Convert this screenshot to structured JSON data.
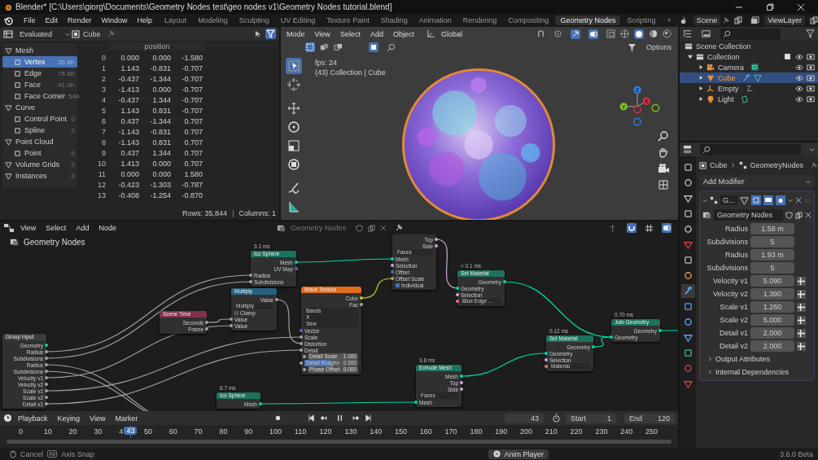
{
  "window": {
    "title": "Blender* [C:\\Users\\giorg\\Documents\\Geometry Nodes test\\geo nodes v1\\Geometry Nodes tutorial.blend]"
  },
  "menu": [
    "File",
    "Edit",
    "Render",
    "Window",
    "Help"
  ],
  "workspaces": [
    {
      "label": "Layout",
      "selected": false
    },
    {
      "label": "Modeling",
      "selected": false
    },
    {
      "label": "Sculpting",
      "selected": false
    },
    {
      "label": "UV Editing",
      "selected": false
    },
    {
      "label": "Texture Paint",
      "selected": false
    },
    {
      "label": "Shading",
      "selected": false
    },
    {
      "label": "Animation",
      "selected": false
    },
    {
      "label": "Rendering",
      "selected": false
    },
    {
      "label": "Compositing",
      "selected": false
    },
    {
      "label": "Geometry Nodes",
      "selected": true
    },
    {
      "label": "Scripting",
      "selected": false
    }
  ],
  "add_workspace": "+",
  "scene": "Scene",
  "view_layer": "ViewLayer",
  "spreadsheet": {
    "mode": "Evaluated",
    "object": "Cube",
    "domains": [
      {
        "label": "Mesh",
        "children": [
          {
            "label": "Vertex",
            "count": "35.8K",
            "selected": true
          },
          {
            "label": "Edge",
            "count": "76.8K",
            "selected": false
          },
          {
            "label": "Face",
            "count": "41.0K",
            "selected": false
          },
          {
            "label": "Face Corner",
            "count": "54K",
            "selected": false
          }
        ]
      },
      {
        "label": "Curve",
        "children": [
          {
            "label": "Control Point",
            "count": "0",
            "selected": false
          },
          {
            "label": "Spline",
            "count": "0",
            "selected": false
          }
        ]
      },
      {
        "label": "Point Cloud",
        "children": [
          {
            "label": "Point",
            "count": "0",
            "selected": false
          }
        ]
      },
      {
        "label": "Volume Grids",
        "count": "0",
        "selected": false
      },
      {
        "label": "Instances",
        "count": "0",
        "selected": false
      }
    ],
    "column": "position",
    "rows": [
      [
        "0",
        "0.000",
        "0.000",
        "-1.580"
      ],
      [
        "1",
        "1.143",
        "-0.831",
        "-0.707"
      ],
      [
        "2",
        "-0.437",
        "-1.344",
        "-0.707"
      ],
      [
        "3",
        "-1.413",
        "0.000",
        "-0.707"
      ],
      [
        "4",
        "-0.437",
        "1.344",
        "-0.707"
      ],
      [
        "5",
        "1.143",
        "0.831",
        "-0.707"
      ],
      [
        "6",
        "0.437",
        "-1.344",
        "0.707"
      ],
      [
        "7",
        "-1.143",
        "-0.831",
        "0.707"
      ],
      [
        "8",
        "-1.143",
        "0.831",
        "0.707"
      ],
      [
        "9",
        "0.437",
        "1.344",
        "0.707"
      ],
      [
        "10",
        "1.413",
        "0.000",
        "0.707"
      ],
      [
        "11",
        "0.000",
        "0.000",
        "1.580"
      ],
      [
        "12",
        "-0.423",
        "-1.303",
        "-0.787"
      ],
      [
        "13",
        "-0.408",
        "-1.254",
        "-0.870"
      ]
    ],
    "rows_count": "Rows: 35,844",
    "separator": "|",
    "columns_count": "Columns: 1"
  },
  "viewport": {
    "menu": [
      "Mode",
      "View",
      "Select",
      "Add",
      "Object"
    ],
    "orientation": "Global",
    "options": "Options",
    "fps": "fps: 24",
    "info": "(43) Collection | Cube",
    "axes": [
      "Z",
      "X",
      "Y"
    ]
  },
  "outliner": {
    "root": "Scene Collection",
    "collection": {
      "label": "Collection",
      "expanded": true,
      "checked": true
    },
    "items": [
      {
        "label": "Camera",
        "kind": "camera",
        "selected": false,
        "expanded": false
      },
      {
        "label": "Cube",
        "kind": "mesh",
        "selected": true,
        "expanded": false
      },
      {
        "label": "Empty",
        "kind": "empty",
        "selected": false,
        "expanded": false
      },
      {
        "label": "Light",
        "kind": "light",
        "selected": false,
        "expanded": false
      }
    ]
  },
  "properties": {
    "object": "Cube",
    "modifier": "GeometryNodes",
    "add_modifier": "Add Modifier",
    "modifier_short": "G...",
    "node_group": "Geometry Nodes",
    "inputs": [
      {
        "label": "Radius",
        "value": "1.58 m",
        "kind": "value"
      },
      {
        "label": "Subdivisions",
        "value": "5",
        "kind": "value"
      },
      {
        "label": "Radius",
        "value": "1.93 m",
        "kind": "value"
      },
      {
        "label": "Subdivisions",
        "value": "5",
        "kind": "value"
      },
      {
        "label": "Velocity v1",
        "value": "5.090",
        "kind": "field"
      },
      {
        "label": "Velocity v2",
        "value": "1.390",
        "kind": "field"
      },
      {
        "label": "Scale v1",
        "value": "1.260",
        "kind": "field"
      },
      {
        "label": "Scale v2",
        "value": "5.000",
        "kind": "field"
      },
      {
        "label": "Detail v1",
        "value": "2.000",
        "kind": "field"
      },
      {
        "label": "Detail v2",
        "value": "2.000",
        "kind": "field"
      }
    ],
    "sections": [
      {
        "label": "Output Attributes",
        "expanded": false
      },
      {
        "label": "Internal Dependencies",
        "expanded": false
      }
    ]
  },
  "node_editor": {
    "menu": [
      "View",
      "Select",
      "Add",
      "Node"
    ],
    "node_group": "Geometry Nodes",
    "breadcrumb": "Geometry Nodes",
    "nodes": [
      {
        "title": "Group Input",
        "color": "#3c3c3c",
        "rows": [
          {
            "kind": "out",
            "label": "Geometry",
            "color": "#00d6a3"
          },
          {
            "kind": "out",
            "label": "Radius",
            "color": "#a1a1a1"
          },
          {
            "kind": "out",
            "label": "Subdivisions",
            "color": "#a1a1a1"
          },
          {
            "kind": "out",
            "label": "Radius",
            "color": "#a1a1a1"
          },
          {
            "kind": "out",
            "label": "Subdivisions",
            "color": "#a1a1a1"
          },
          {
            "kind": "out",
            "label": "Velocity v1",
            "color": "#a1a1a1"
          },
          {
            "kind": "out",
            "label": "Velocity v2",
            "color": "#a1a1a1"
          },
          {
            "kind": "out",
            "label": "Scale v1",
            "color": "#a1a1a1"
          },
          {
            "kind": "out",
            "label": "Scale v2",
            "color": "#a1a1a1"
          },
          {
            "kind": "out",
            "label": "Detail v1",
            "color": "#a1a1a1"
          }
        ]
      },
      {
        "title": "Ico Sphere",
        "time": "3.1 ms",
        "color": "#1d725e",
        "rows": [
          {
            "kind": "out",
            "label": "Mesh",
            "color": "#00d6a3"
          },
          {
            "kind": "out",
            "label": "UV Map",
            "color": "#6363c7"
          },
          {
            "kind": "in",
            "label": "Radius",
            "color": "#a1a1a1"
          },
          {
            "kind": "in",
            "label": "Subdivisions",
            "color": "#a1a1a1"
          }
        ]
      },
      {
        "title": "Multiply",
        "color": "#246283",
        "rows": [
          {
            "kind": "out",
            "label": "Value",
            "color": "#a1a1a1"
          },
          {
            "kind": "menu",
            "label": "Multiply"
          },
          {
            "kind": "check",
            "label": "Clamp",
            "checked": false
          },
          {
            "kind": "in",
            "label": "Value",
            "color": "#a1a1a1"
          },
          {
            "kind": "in",
            "label": "Value",
            "color": "#a1a1a1"
          }
        ]
      },
      {
        "title": "Scene Time",
        "color": "#83314a",
        "rows": [
          {
            "kind": "out",
            "label": "Seconds",
            "color": "#a1a1a1"
          },
          {
            "kind": "out",
            "label": "Frame",
            "color": "#a1a1a1"
          }
        ]
      },
      {
        "title": "Wave Texture",
        "color": "#e06c1c",
        "rows": [
          {
            "kind": "out",
            "label": "Color",
            "color": "#c7c729"
          },
          {
            "kind": "out",
            "label": "Fac",
            "color": "#a1a1a1"
          },
          {
            "kind": "menu",
            "label": "Bands"
          },
          {
            "kind": "menu",
            "label": "X"
          },
          {
            "kind": "menu",
            "label": "Sine"
          },
          {
            "kind": "in",
            "label": "Vector",
            "color": "#6363c7"
          },
          {
            "kind": "in",
            "label": "Scale",
            "color": "#a1a1a1"
          },
          {
            "kind": "in",
            "label": "Distortion",
            "color": "#a1a1a1"
          },
          {
            "kind": "in",
            "label": "Detail",
            "color": "#a1a1a1"
          },
          {
            "kind": "field",
            "label": "Detail Scale",
            "value": "1.000",
            "color": "#a1a1a1"
          },
          {
            "kind": "slider",
            "label": "Detail Roughn",
            "value": "0.500",
            "level": 0.5,
            "color": "#a1a1a1"
          },
          {
            "kind": "field",
            "label": "Phase Offset",
            "value": "0.000",
            "color": "#a1a1a1"
          }
        ]
      },
      {
        "title": "Ico Sphere",
        "time": "6.7 ms",
        "color": "#1d725e",
        "rows": [
          {
            "kind": "out",
            "label": "Mesh",
            "color": "#00d6a3"
          }
        ]
      },
      {
        "rows": [
          {
            "kind": "out",
            "label": "Top",
            "color": "#cca6d6"
          },
          {
            "kind": "out",
            "label": "Side",
            "color": "#cca6d6"
          },
          {
            "kind": "menu",
            "label": "Faces"
          },
          {
            "kind": "in",
            "label": "Mesh",
            "color": "#00d6a3"
          },
          {
            "kind": "in",
            "label": "Selection",
            "color": "#cca6d6"
          },
          {
            "kind": "in",
            "label": "Offset",
            "color": "#6363c7"
          },
          {
            "kind": "in",
            "label": "Offset Scale",
            "color": "#a1a1a1"
          },
          {
            "kind": "check",
            "label": "Individual",
            "checked": true
          }
        ]
      },
      {
        "title": "Set Material",
        "time": "< 0.1 ms",
        "color": "#1d725e",
        "rows": [
          {
            "kind": "out",
            "label": "Geometry",
            "color": "#00d6a3"
          },
          {
            "kind": "in",
            "label": "Geometry",
            "color": "#00d6a3"
          },
          {
            "kind": "in",
            "label": "Selection",
            "color": "#cca6d6"
          },
          {
            "kind": "material",
            "label": "Blue Edge ...",
            "color": "#eb7582"
          }
        ]
      },
      {
        "title": "Set Material",
        "time": "0.12 ms",
        "color": "#1d725e",
        "rows": [
          {
            "kind": "out",
            "label": "Geometry",
            "color": "#00d6a3"
          },
          {
            "kind": "in",
            "label": "Geometry",
            "color": "#00d6a3"
          },
          {
            "kind": "in",
            "label": "Selection",
            "color": "#cca6d6"
          },
          {
            "kind": "material",
            "label": "Material",
            "color": "#eb7582"
          }
        ]
      },
      {
        "title": "Join Geometry",
        "time": "0.70 ms",
        "color": "#1d725e",
        "rows": [
          {
            "kind": "out",
            "label": "Geometry",
            "color": "#00d6a3"
          },
          {
            "kind": "in",
            "label": "Geometry",
            "color": "#00d6a3"
          }
        ]
      },
      {
        "title": "Extrude Mesh",
        "time": "3.8 ms",
        "color": "#1d725e",
        "rows": [
          {
            "kind": "out",
            "label": "Mesh",
            "color": "#00d6a3"
          },
          {
            "kind": "out",
            "label": "Top",
            "color": "#cca6d6"
          },
          {
            "kind": "out",
            "label": "Side",
            "color": "#cca6d6"
          },
          {
            "kind": "menu",
            "label": "Faces"
          },
          {
            "kind": "in",
            "label": "Mesh",
            "color": "#00d6a3"
          }
        ]
      }
    ]
  },
  "timeline": {
    "menu": [
      "Playback",
      "Keying",
      "View",
      "Marker"
    ],
    "frame": "43",
    "start_label": "Start",
    "start": "1",
    "end_label": "End",
    "end": "120",
    "playhead": "43",
    "ruler": [
      "0",
      "10",
      "20",
      "30",
      "4",
      "50",
      "60",
      "70",
      "80",
      "90",
      "100",
      "110",
      "120",
      "130",
      "140",
      "150",
      "160",
      "170",
      "180",
      "190",
      "200",
      "210",
      "220",
      "230",
      "240",
      "250"
    ]
  },
  "status": {
    "cancel": "Cancel",
    "key": "Alt",
    "axis_snap": "Axis Snap",
    "center": "Anim Player",
    "version": "3.6.0 Beta"
  }
}
